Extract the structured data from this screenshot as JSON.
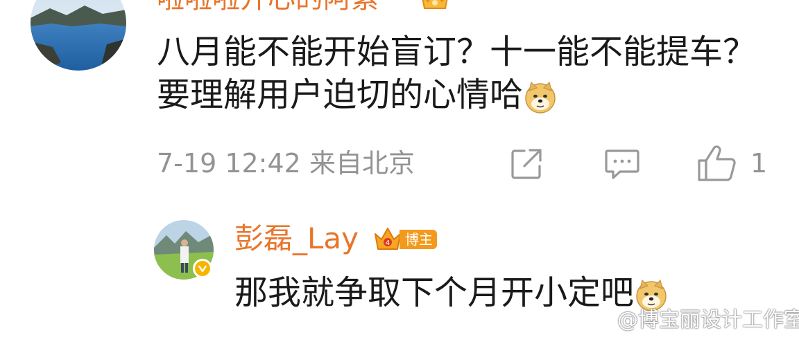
{
  "comment1": {
    "username": "啦啦啦开心的阿紫",
    "text": "八月能不能开始盲订？十一能不能提车？要理解用户迫切的心情哈",
    "timestamp": "7-19 12:42",
    "location": "来自北京",
    "like_count": "1",
    "icons": [
      "crown-icon",
      "doge-emoji",
      "share-icon",
      "reply-icon",
      "like-icon"
    ]
  },
  "comment2": {
    "username": "彭磊_Lay",
    "badge_label": "博主",
    "text": "那我就争取下个月开小定吧",
    "icons": [
      "verified-icon",
      "vip-crown-icon",
      "doge-emoji"
    ]
  },
  "watermark": {
    "text": "@博宝丽设计工作室"
  },
  "colors": {
    "username": "#e8752b",
    "meta": "#939393",
    "badge": "#f39a1d",
    "text": "#1a1a1a"
  }
}
